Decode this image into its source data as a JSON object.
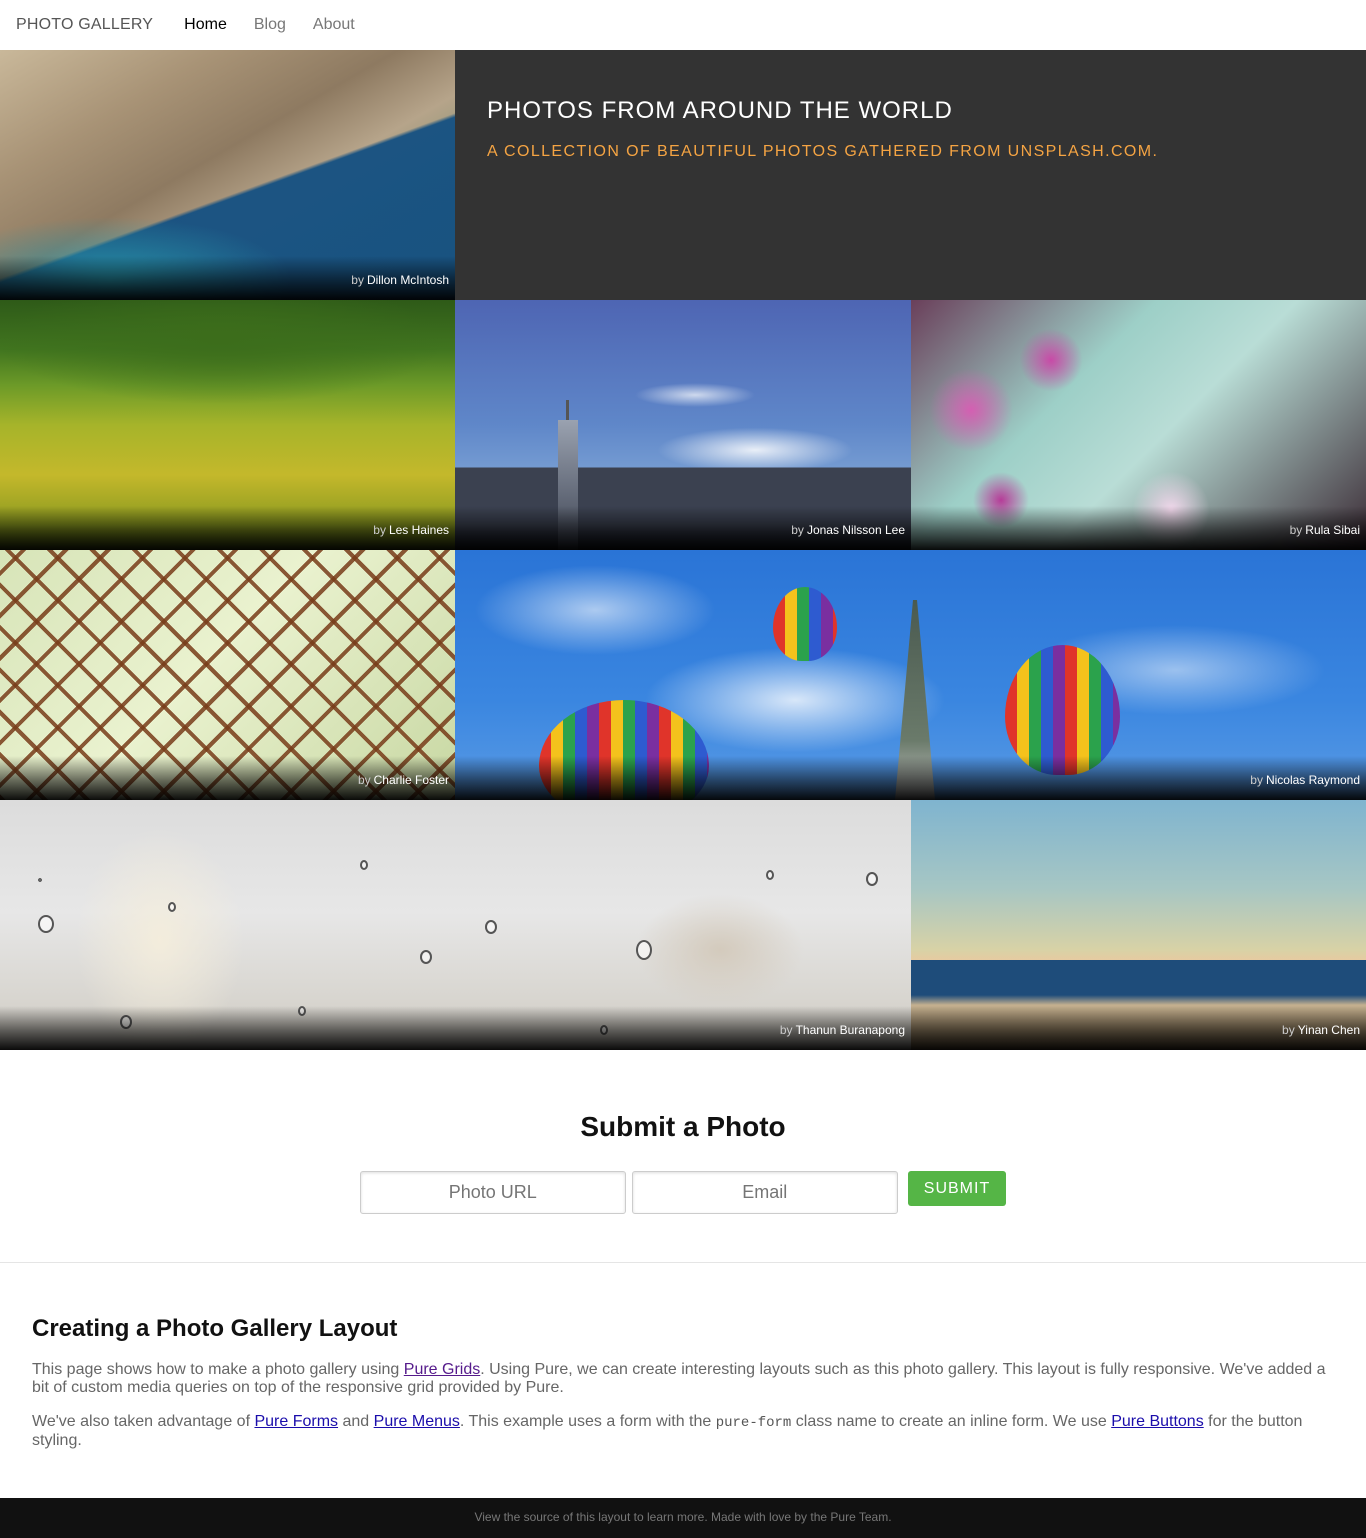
{
  "header": {
    "brand": "PHOTO GALLERY",
    "nav": [
      {
        "label": "Home",
        "active": true
      },
      {
        "label": "Blog",
        "active": false
      },
      {
        "label": "About",
        "active": false
      }
    ]
  },
  "intro": {
    "title": "PHOTOS FROM AROUND THE WORLD",
    "subtitle": "A COLLECTION OF BEAUTIFUL PHOTOS GATHERED FROM UNSPLASH.COM."
  },
  "photos": [
    {
      "by": "by",
      "author": "Dillon McIntosh"
    },
    {
      "by": "by",
      "author": "Les Haines"
    },
    {
      "by": "by",
      "author": "Jonas Nilsson Lee"
    },
    {
      "by": "by",
      "author": "Rula Sibai"
    },
    {
      "by": "by",
      "author": "Charlie Foster"
    },
    {
      "by": "by",
      "author": "Nicolas Raymond"
    },
    {
      "by": "by",
      "author": "Thanun Buranapong"
    },
    {
      "by": "by",
      "author": "Yinan Chen"
    }
  ],
  "submit": {
    "title": "Submit a Photo",
    "url_placeholder": "Photo URL",
    "email_placeholder": "Email",
    "button": "SUBMIT"
  },
  "content": {
    "title": "Creating a Photo Gallery Layout",
    "p1": {
      "t1": "This page shows how to make a photo gallery using ",
      "link1": "Pure Grids",
      "t2": ". Using Pure, we can create interesting layouts such as this photo gallery. This layout is fully responsive. We've added a bit of custom media queries on top of the responsive grid provided by Pure."
    },
    "p2": {
      "t1": "We've also taken advantage of ",
      "link1": "Pure Forms",
      "t2": " and ",
      "link2": "Pure Menus",
      "t3": ". This example uses a form with the ",
      "code": "pure-form",
      "t4": " class name to create an inline form. We use ",
      "link3": "Pure Buttons",
      "t5": " for the button styling."
    }
  },
  "footer": {
    "text": "View the source of this layout to learn more. Made with love by the Pure Team."
  }
}
